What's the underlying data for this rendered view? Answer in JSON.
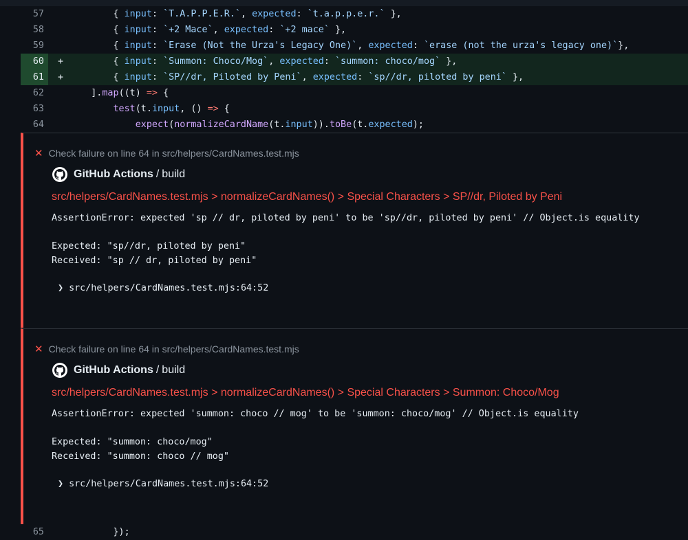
{
  "code_lines": [
    {
      "num": "57",
      "marker": "",
      "added": false,
      "tokens": [
        {
          "t": "        { ",
          "c": "plain"
        },
        {
          "t": "input",
          "c": "prop"
        },
        {
          "t": ": ",
          "c": "plain"
        },
        {
          "t": "`T.A.P.P.E.R.`",
          "c": "str"
        },
        {
          "t": ", ",
          "c": "plain"
        },
        {
          "t": "expected",
          "c": "prop"
        },
        {
          "t": ": ",
          "c": "plain"
        },
        {
          "t": "`t.a.p.p.e.r.`",
          "c": "str"
        },
        {
          "t": " },",
          "c": "plain"
        }
      ]
    },
    {
      "num": "58",
      "marker": "",
      "added": false,
      "tokens": [
        {
          "t": "        { ",
          "c": "plain"
        },
        {
          "t": "input",
          "c": "prop"
        },
        {
          "t": ": ",
          "c": "plain"
        },
        {
          "t": "`+2 Mace`",
          "c": "str"
        },
        {
          "t": ", ",
          "c": "plain"
        },
        {
          "t": "expected",
          "c": "prop"
        },
        {
          "t": ": ",
          "c": "plain"
        },
        {
          "t": "`+2 mace`",
          "c": "str"
        },
        {
          "t": " },",
          "c": "plain"
        }
      ]
    },
    {
      "num": "59",
      "marker": "",
      "added": false,
      "tokens": [
        {
          "t": "        { ",
          "c": "plain"
        },
        {
          "t": "input",
          "c": "prop"
        },
        {
          "t": ": ",
          "c": "plain"
        },
        {
          "t": "`Erase (Not the Urza's Legacy One)`",
          "c": "str"
        },
        {
          "t": ", ",
          "c": "plain"
        },
        {
          "t": "expected",
          "c": "prop"
        },
        {
          "t": ": ",
          "c": "plain"
        },
        {
          "t": "`erase (not the urza's legacy one)`",
          "c": "str"
        },
        {
          "t": "},",
          "c": "plain"
        }
      ]
    },
    {
      "num": "60",
      "marker": "+",
      "added": true,
      "tokens": [
        {
          "t": "        { ",
          "c": "plain"
        },
        {
          "t": "input",
          "c": "prop"
        },
        {
          "t": ": ",
          "c": "plain"
        },
        {
          "t": "`Summon: Choco/Mog`",
          "c": "str"
        },
        {
          "t": ", ",
          "c": "plain"
        },
        {
          "t": "expected",
          "c": "prop"
        },
        {
          "t": ": ",
          "c": "plain"
        },
        {
          "t": "`summon: choco/mog`",
          "c": "str"
        },
        {
          "t": " },",
          "c": "plain"
        }
      ]
    },
    {
      "num": "61",
      "marker": "+",
      "added": true,
      "tokens": [
        {
          "t": "        { ",
          "c": "plain"
        },
        {
          "t": "input",
          "c": "prop"
        },
        {
          "t": ": ",
          "c": "plain"
        },
        {
          "t": "`SP//dr, Piloted by Peni`",
          "c": "str"
        },
        {
          "t": ", ",
          "c": "plain"
        },
        {
          "t": "expected",
          "c": "prop"
        },
        {
          "t": ": ",
          "c": "plain"
        },
        {
          "t": "`sp//dr, piloted by peni`",
          "c": "str"
        },
        {
          "t": " },",
          "c": "plain"
        }
      ]
    },
    {
      "num": "62",
      "marker": "",
      "added": false,
      "tokens": [
        {
          "t": "    ].",
          "c": "plain"
        },
        {
          "t": "map",
          "c": "fn"
        },
        {
          "t": "((t) ",
          "c": "plain"
        },
        {
          "t": "=>",
          "c": "kw"
        },
        {
          "t": " {",
          "c": "plain"
        }
      ]
    },
    {
      "num": "63",
      "marker": "",
      "added": false,
      "tokens": [
        {
          "t": "        ",
          "c": "plain"
        },
        {
          "t": "test",
          "c": "fn"
        },
        {
          "t": "(t.",
          "c": "plain"
        },
        {
          "t": "input",
          "c": "prop"
        },
        {
          "t": ", () ",
          "c": "plain"
        },
        {
          "t": "=>",
          "c": "kw"
        },
        {
          "t": " {",
          "c": "plain"
        }
      ]
    },
    {
      "num": "64",
      "marker": "",
      "added": false,
      "tokens": [
        {
          "t": "            ",
          "c": "plain"
        },
        {
          "t": "expect",
          "c": "fn"
        },
        {
          "t": "(",
          "c": "plain"
        },
        {
          "t": "normalizeCardName",
          "c": "fn"
        },
        {
          "t": "(t.",
          "c": "plain"
        },
        {
          "t": "input",
          "c": "prop"
        },
        {
          "t": ")).",
          "c": "plain"
        },
        {
          "t": "toBe",
          "c": "fn"
        },
        {
          "t": "(t.",
          "c": "plain"
        },
        {
          "t": "expected",
          "c": "prop"
        },
        {
          "t": ");",
          "c": "plain"
        }
      ]
    }
  ],
  "annotations": [
    {
      "header": "Check failure on line 64 in src/helpers/CardNames.test.mjs",
      "source_app": "GitHub Actions",
      "source_sep": "/",
      "source_job": "build",
      "title": "src/helpers/CardNames.test.mjs > normalizeCardNames() > Special Characters > SP//dr, Piloted by Peni",
      "error_line": "AssertionError: expected 'sp // dr, piloted by peni' to be 'sp//dr, piloted by peni' // Object.is equality",
      "expected_line": "Expected: \"sp//dr, piloted by peni\"",
      "received_line": "Received: \"sp // dr, piloted by peni\"",
      "location": "src/helpers/CardNames.test.mjs:64:52"
    },
    {
      "header": "Check failure on line 64 in src/helpers/CardNames.test.mjs",
      "source_app": "GitHub Actions",
      "source_sep": "/",
      "source_job": "build",
      "title": "src/helpers/CardNames.test.mjs > normalizeCardNames() > Special Characters > Summon: Choco/Mog",
      "error_line": "AssertionError: expected 'summon: choco // mog' to be 'summon: choco/mog' // Object.is equality",
      "expected_line": "Expected: \"summon: choco/mog\"",
      "received_line": "Received: \"summon: choco // mog\"",
      "location": "src/helpers/CardNames.test.mjs:64:52"
    }
  ],
  "bottom_line": {
    "num": "65",
    "code": "        });"
  },
  "icons": {
    "fail": "x-icon",
    "chevron": "chevron-right-icon",
    "github": "github-icon"
  },
  "colors": {
    "fail": "#f85149",
    "added_bg": "#12261e",
    "added_gutter": "#1f4a2e"
  }
}
